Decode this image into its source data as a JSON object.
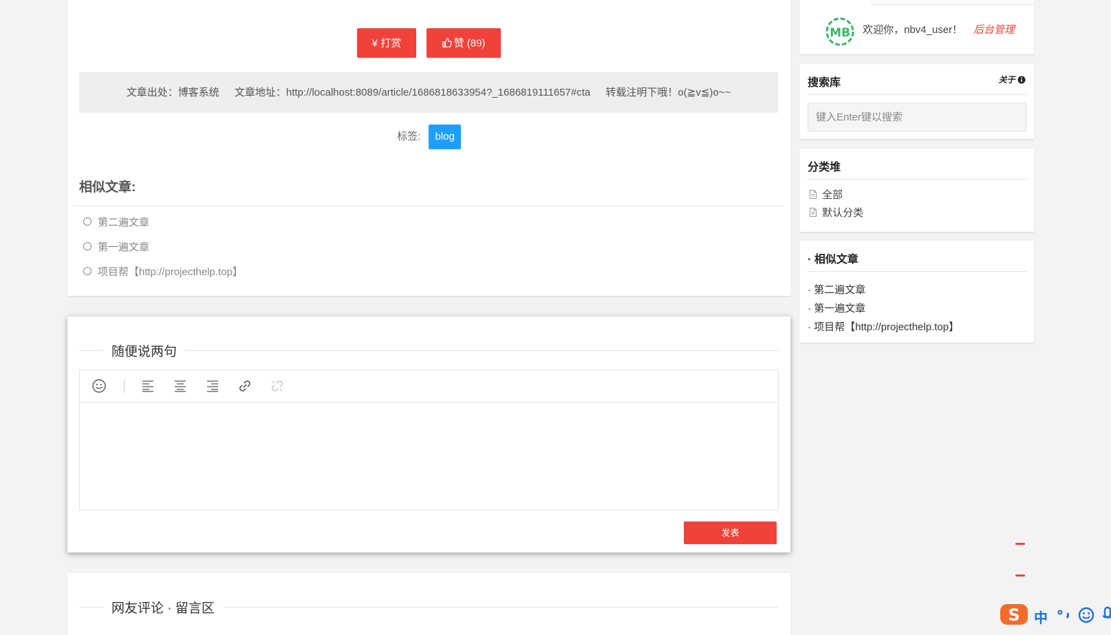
{
  "article": {
    "reward_label": "¥ 打赏",
    "like_label": "赞 (89)",
    "source_label": "文章出处：博客系统",
    "url_label": "文章地址：http://localhost:8089/article/1686818633954?_1686819111657#cta",
    "repost_note": "转载注明下哦！o(≧v≦)o~~",
    "tags_label": "标签:",
    "tags": [
      "blog"
    ],
    "similar_title": "相似文章:",
    "similar_items": [
      "第二遍文章",
      "第一遍文章",
      "项目帮【http://projecthelp.top】"
    ]
  },
  "editor": {
    "heading": "随便说两句",
    "submit_label": "发表",
    "content": ""
  },
  "comments": {
    "heading": "网友评论 · 留言区"
  },
  "sidebar": {
    "welcome_text": "欢迎你，nbv4_user！",
    "admin_link": "后台管理",
    "search": {
      "title": "搜索库",
      "about_label": "关于",
      "placeholder": "键入Enter键以搜索"
    },
    "categories": {
      "title": "分类堆",
      "items": [
        "全部",
        "默认分类"
      ]
    },
    "related": {
      "title": "· 相似文章",
      "items": [
        "· 第二遍文章",
        "· 第一遍文章",
        "· 项目帮【http://projecthelp.top】"
      ]
    }
  },
  "ime": {
    "mode_label": "中"
  },
  "colors": {
    "accent_red": "#f0423a",
    "tag_blue": "#1e9fff",
    "logo_green": "#3bb56a"
  }
}
